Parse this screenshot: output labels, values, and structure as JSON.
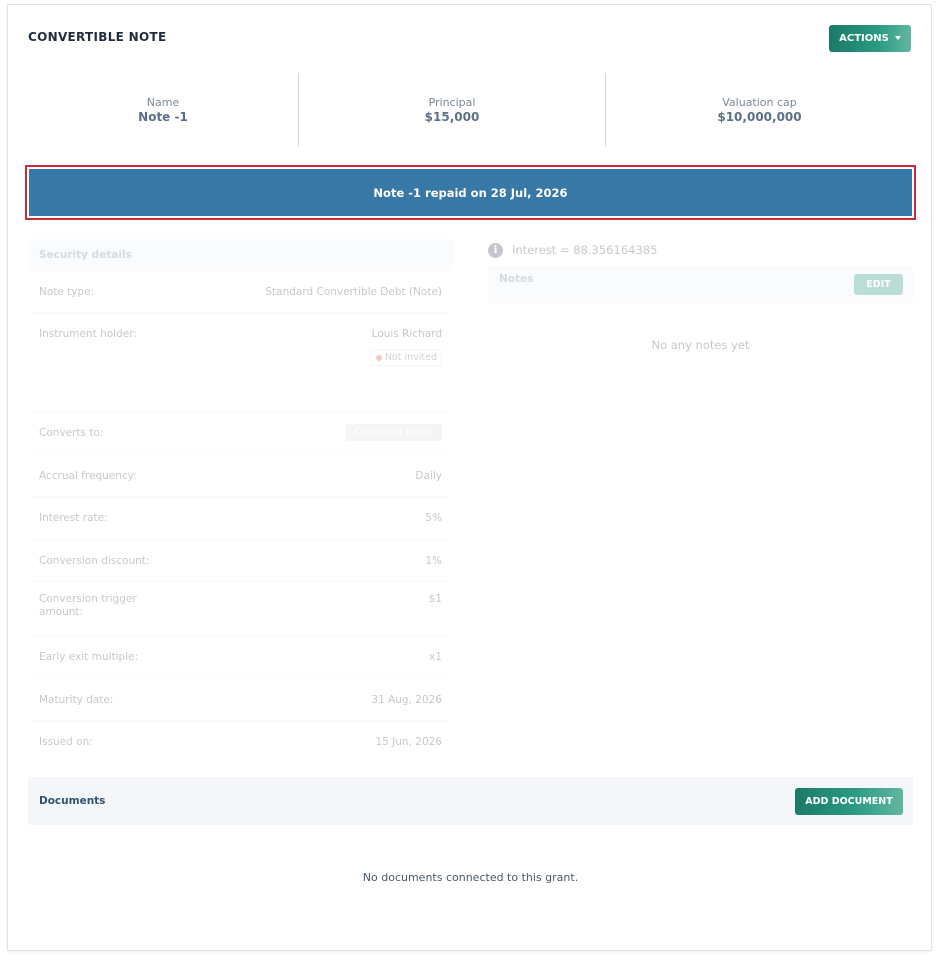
{
  "header": {
    "title": "CONVERTIBLE NOTE",
    "actions_label": "ACTIONS"
  },
  "summary": [
    {
      "label": "Name",
      "value": "Note -1"
    },
    {
      "label": "Principal",
      "value": "$15,000"
    },
    {
      "label": "Valuation cap",
      "value": "$10,000,000"
    }
  ],
  "banner": {
    "text": "Note -1 repaid on 28 Jul, 2026",
    "color": "#3778a7",
    "outline_color": "#c62d37"
  },
  "security_details": {
    "title": "Security details",
    "rows": [
      {
        "label": "Note type:",
        "value": "Standard Convertible Debt (Note)"
      },
      {
        "label": "Instrument holder:",
        "value": "Louis Richard",
        "badge": "Not invited"
      },
      {
        "label": "Converts to:",
        "value": "Common stock"
      },
      {
        "label": "Accrual frequency:",
        "value": "Daily"
      },
      {
        "label": "Interest rate:",
        "value": "5%"
      },
      {
        "label": "Conversion discount:",
        "value": "1%"
      },
      {
        "label": "Conversion trigger amount:",
        "value": "$1"
      },
      {
        "label": "Early exit multiple:",
        "value": "x1"
      },
      {
        "label": "Maturity date:",
        "value": "31 Aug, 2026"
      },
      {
        "label": "Issued on:",
        "value": "15 Jun, 2026"
      }
    ]
  },
  "interest": {
    "text": "Interest = 88.356164385",
    "icon": "info-icon"
  },
  "notes": {
    "title": "Notes",
    "edit_label": "EDIT",
    "empty_text": "No any notes yet"
  },
  "documents": {
    "title": "Documents",
    "add_label": "ADD DOCUMENT",
    "empty_text": "No documents connected to this grant."
  },
  "colors": {
    "accent": "#2b9a82",
    "accent_dark": "#1a7a68"
  }
}
